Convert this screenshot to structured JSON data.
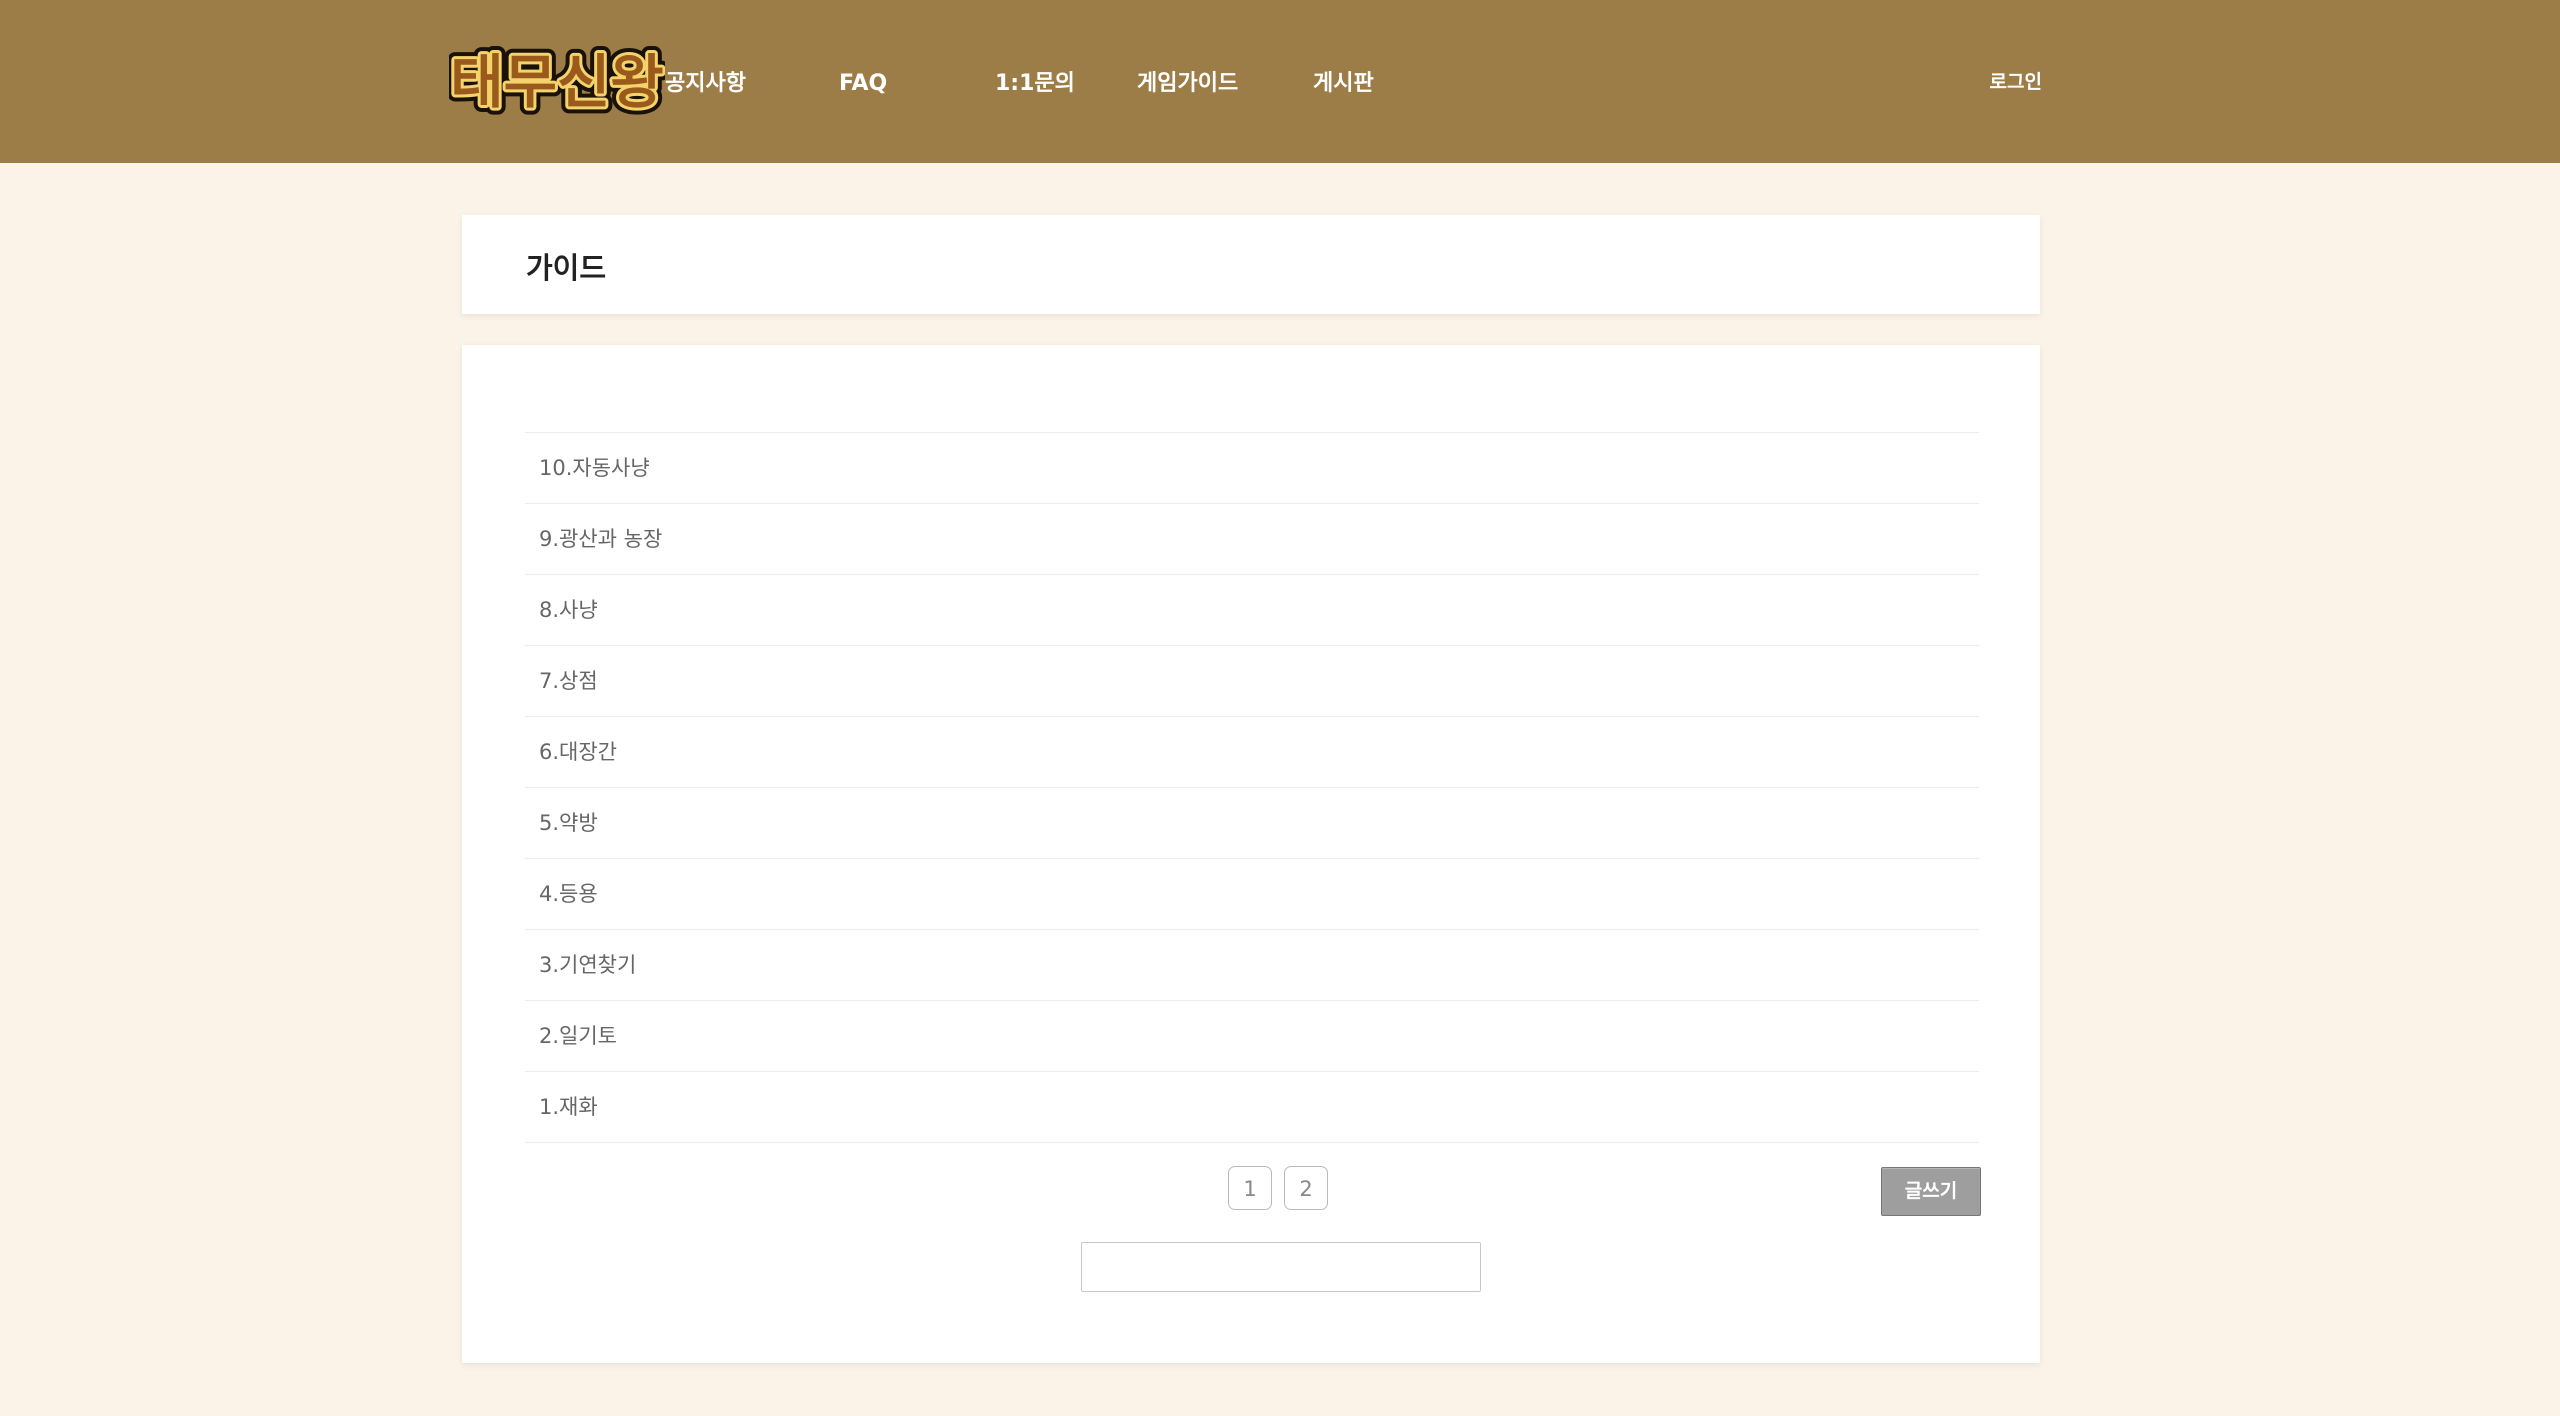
{
  "header": {
    "logo_text": "태무신왕",
    "nav": [
      "공지사항",
      "FAQ",
      "1:1문의",
      "게임가이드",
      "게시판"
    ],
    "login_label": "로그인",
    "colors": {
      "header_bg": "#9c7d48",
      "page_bg": "#fcf3e8"
    }
  },
  "page": {
    "title": "가이드"
  },
  "posts": [
    "10.자동사냥",
    "9.광산과 농장",
    "8.사냥",
    "7.상점",
    "6.대장간",
    "5.약방",
    "4.등용",
    "3.기연찾기",
    "2.일기토",
    "1.재화"
  ],
  "pagination": {
    "pages": [
      "1",
      "2"
    ]
  },
  "write_label": "글쓰기",
  "search": {
    "value": "",
    "placeholder": ""
  }
}
